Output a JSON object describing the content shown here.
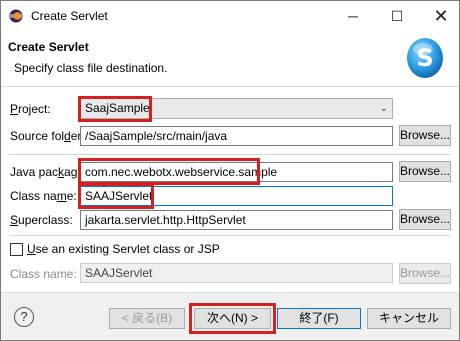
{
  "window": {
    "title": "Create Servlet",
    "minimize": "─",
    "maximize": "☐",
    "close": "✕"
  },
  "banner": {
    "title": "Create Servlet",
    "description": "Specify class file destination."
  },
  "form": {
    "project": {
      "label_key": "P",
      "label_rest": "roject:",
      "value": "SaajSample"
    },
    "source_folder": {
      "label_pre": "Source fol",
      "label_key": "d",
      "label_rest": "er:",
      "value": "/SaajSample/src/main/java",
      "browse": "Browse..."
    },
    "java_package": {
      "label_pre": "Java pac",
      "label_key": "k",
      "label_rest": "age:",
      "value": "com.nec.webotx.webservice.sample",
      "browse": "Browse..."
    },
    "class_name": {
      "label_pre": "Class na",
      "label_key": "m",
      "label_rest": "e:",
      "value": "SAAJServlet"
    },
    "superclass": {
      "label_key": "S",
      "label_rest": "uperclass:",
      "value": "jakarta.servlet.http.HttpServlet",
      "browse": "Browse..."
    },
    "existing": {
      "label_key": "U",
      "label_rest": "se an existing Servlet class or JSP"
    },
    "existing_class": {
      "label": "Class name:",
      "value": "SAAJServlet",
      "browse": "Browse..."
    }
  },
  "footer": {
    "help": "?",
    "back": "< 戻る(B)",
    "next": "次へ(N) >",
    "finish": "終了(F)",
    "cancel": "キャンセル"
  }
}
